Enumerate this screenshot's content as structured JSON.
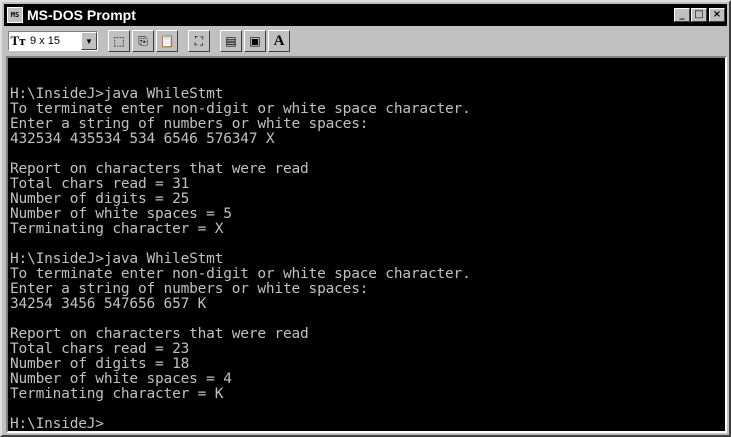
{
  "window": {
    "title": "MS-DOS Prompt",
    "icon_label": "MS",
    "buttons": {
      "minimize": "_",
      "maximize": "□",
      "close": "×"
    }
  },
  "toolbar": {
    "font_icon": "Tт",
    "font_size": "9 x 15",
    "dropdown_icon": "▼",
    "buttons": [
      {
        "name": "mark-icon",
        "glyph": "⬚"
      },
      {
        "name": "copy-icon",
        "glyph": "⎘"
      },
      {
        "name": "paste-icon",
        "glyph": "📋"
      },
      {
        "name": "fullscreen-icon",
        "glyph": "⛶"
      },
      {
        "name": "properties-icon",
        "glyph": "▤"
      },
      {
        "name": "background-icon",
        "glyph": "▣"
      },
      {
        "name": "font-icon",
        "glyph": "A"
      }
    ]
  },
  "console": {
    "lines": [
      "",
      "H:\\InsideJ>java WhileStmt",
      "To terminate enter non-digit or white space character.",
      "Enter a string of numbers or white spaces:",
      "432534 435534 534 6546 576347 X",
      "",
      "Report on characters that were read",
      "Total chars read = 31",
      "Number of digits = 25",
      "Number of white spaces = 5",
      "Terminating character = X",
      "",
      "H:\\InsideJ>java WhileStmt",
      "To terminate enter non-digit or white space character.",
      "Enter a string of numbers or white spaces:",
      "34254 3456 547656 657 K",
      "",
      "Report on characters that were read",
      "Total chars read = 23",
      "Number of digits = 18",
      "Number of white spaces = 4",
      "Terminating character = K",
      "",
      "H:\\InsideJ>"
    ]
  },
  "colors": {
    "titlebar": "#000000",
    "console_bg": "#000000",
    "console_text": "#c0c0c0",
    "chrome": "#c0c0c0"
  }
}
